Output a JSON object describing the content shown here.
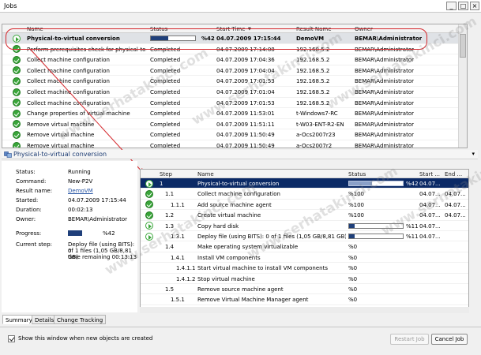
{
  "window": {
    "title": "Jobs"
  },
  "jobs": {
    "headers": {
      "name": "Name",
      "status": "Status",
      "start": "Start Time",
      "sort": "▼",
      "result": "Result Name",
      "owner": "Owner"
    },
    "rows": [
      {
        "icon": "run",
        "name": "Physical-to-virtual conversion",
        "status": "",
        "progress": "%42",
        "progress_value": 42,
        "start": "04.07.2009 17:15:44",
        "result": "DemoVM",
        "owner": "BEMAR\\Administrator"
      },
      {
        "icon": "ok",
        "name": "Perform prerequisites check for physical-to-vi...",
        "status": "Completed",
        "start": "04.07.2009 17:14:08",
        "result": "192.168.5.2",
        "owner": "BEMAR\\Administrator"
      },
      {
        "icon": "ok",
        "name": "Collect machine configuration",
        "status": "Completed",
        "start": "04.07.2009 17:04:36",
        "result": "192.168.5.2",
        "owner": "BEMAR\\Administrator"
      },
      {
        "icon": "ok",
        "name": "Collect machine configuration",
        "status": "Completed",
        "start": "04.07.2009 17:04:04",
        "result": "192.168.5.2",
        "owner": "BEMAR\\Administrator"
      },
      {
        "icon": "ok",
        "name": "Collect machine configuration",
        "status": "Completed",
        "start": "04.07.2009 17:01:53",
        "result": "192.168.5.2",
        "owner": "BEMAR\\Administrator"
      },
      {
        "icon": "ok",
        "name": "Collect machine configuration",
        "status": "Completed",
        "start": "04.07.2009 17:01:04",
        "result": "192.168.5.2",
        "owner": "BEMAR\\Administrator"
      },
      {
        "icon": "ok",
        "name": "Collect machine configuration",
        "status": "Completed",
        "start": "04.07.2009 17:01:53",
        "result": "192.168.5.2",
        "owner": "BEMAR\\Administrator"
      },
      {
        "icon": "ok",
        "name": "Change properties of virtual machine",
        "status": "Completed",
        "start": "04.07.2009 11:53:01",
        "result": "t-Windows7-RC",
        "owner": "BEMAR\\Administrator"
      },
      {
        "icon": "ok",
        "name": "Remove virtual machine",
        "status": "Completed",
        "start": "04.07.2009 11:51:11",
        "result": "t-W03-ENT-R2-EN",
        "owner": "BEMAR\\Administrator"
      },
      {
        "icon": "ok",
        "name": "Remove virtual machine",
        "status": "Completed",
        "start": "04.07.2009 11:50:49",
        "result": "a-Ocs2007r23",
        "owner": "BEMAR\\Administrator"
      },
      {
        "icon": "ok",
        "name": "Remove virtual machine",
        "status": "Completed",
        "start": "04.07.2009 11:50:49",
        "result": "a-Ocs2007r2",
        "owner": "BEMAR\\Administrator"
      }
    ]
  },
  "detail": {
    "title": "Physical-to-virtual conversion",
    "props": [
      {
        "label": "Status:",
        "value": "Running"
      },
      {
        "label": "Command:",
        "value": "New-P2V"
      },
      {
        "label": "Result name:",
        "value": "DemoVM",
        "link": true
      },
      {
        "label": "Started:",
        "value": "04.07.2009 17:15:44"
      },
      {
        "label": "Duration:",
        "value": "00:02:13"
      },
      {
        "label": "Owner:",
        "value": "BEMAR\\Administrator"
      }
    ],
    "progress_label": "Progress:",
    "progress_text": "%42",
    "progress_value": 42,
    "current_step_label": "Current step:",
    "current_step_lines": [
      "Deploy file (using BITS): 0",
      "of 1 files (1,05 GB/8,81 GB)",
      "time remaining 00:13:13"
    ]
  },
  "steps": {
    "headers": {
      "step": "Step",
      "name": "Name",
      "status": "Status",
      "start": "Start ...",
      "end": "End ..."
    },
    "rows": [
      {
        "icon": "run",
        "step": "1",
        "name": "Physical-to-virtual conversion",
        "status": "%42",
        "bar": 42,
        "start": "04.07...",
        "end": ""
      },
      {
        "icon": "ok",
        "step": "1.1",
        "name": "Collect machine configuration",
        "status": "%100",
        "start": "04.07...",
        "end": "04.07..."
      },
      {
        "icon": "ok",
        "step": "1.1.1",
        "name": "Add source machine agent",
        "status": "%100",
        "start": "04.07...",
        "end": "04.07..."
      },
      {
        "icon": "ok",
        "step": "1.2",
        "name": "Create virtual machine",
        "status": "%100",
        "start": "04.07...",
        "end": "04.07..."
      },
      {
        "icon": "run",
        "step": "1.3",
        "name": "Copy hard disk",
        "status": "%11",
        "bar": 11,
        "start": "04.07...",
        "end": ""
      },
      {
        "icon": "run",
        "step": "1.3.1",
        "name": "Deploy file (using BITS): 0 of 1 files (1,05 GB/8,81 GB) tim...",
        "status": "%11",
        "bar": 11,
        "start": "04.07...",
        "end": ""
      },
      {
        "icon": "",
        "step": "1.4",
        "name": "Make operating system virtualizable",
        "status": "%0",
        "start": "",
        "end": ""
      },
      {
        "icon": "",
        "step": "1.4.1",
        "name": "Install VM components",
        "status": "%0",
        "start": "",
        "end": ""
      },
      {
        "icon": "",
        "step": "1.4.1.1",
        "name": "Start virtual machine to install VM components",
        "status": "%0",
        "start": "",
        "end": ""
      },
      {
        "icon": "",
        "step": "1.4.1.2",
        "name": "Stop virtual machine",
        "status": "%0",
        "start": "",
        "end": ""
      },
      {
        "icon": "",
        "step": "1.5",
        "name": "Remove source machine agent",
        "status": "%0",
        "start": "",
        "end": ""
      },
      {
        "icon": "",
        "step": "1.5.1",
        "name": "Remove Virtual Machine Manager agent",
        "status": "%0",
        "start": "",
        "end": ""
      }
    ]
  },
  "tabs": [
    "Summary",
    "Details",
    "Change Tracking"
  ],
  "footer": {
    "checkbox_label": "Show this window when new objects are created",
    "checked": true,
    "restart_label": "Restart Job",
    "cancel_label": "Cancel Job"
  },
  "watermark": "www.serhatakinci.com",
  "colors": {
    "selection_ring": "#d4262b",
    "progress_fill": "#1f3f7a",
    "selected_step": "#0b2a66",
    "link": "#2553a3"
  }
}
